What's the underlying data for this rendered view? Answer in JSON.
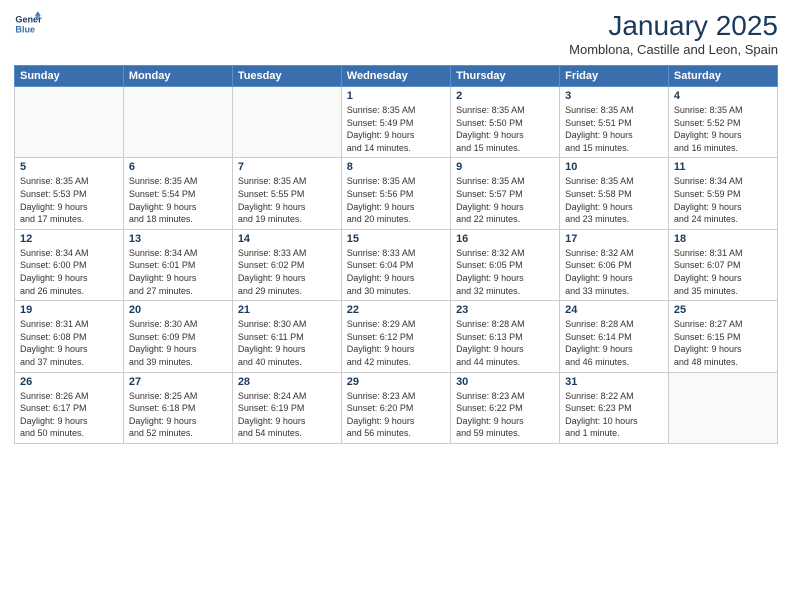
{
  "logo": {
    "line1": "General",
    "line2": "Blue"
  },
  "title": "January 2025",
  "subtitle": "Momblona, Castille and Leon, Spain",
  "weekdays": [
    "Sunday",
    "Monday",
    "Tuesday",
    "Wednesday",
    "Thursday",
    "Friday",
    "Saturday"
  ],
  "weeks": [
    [
      {
        "day": "",
        "info": ""
      },
      {
        "day": "",
        "info": ""
      },
      {
        "day": "",
        "info": ""
      },
      {
        "day": "1",
        "info": "Sunrise: 8:35 AM\nSunset: 5:49 PM\nDaylight: 9 hours\nand 14 minutes."
      },
      {
        "day": "2",
        "info": "Sunrise: 8:35 AM\nSunset: 5:50 PM\nDaylight: 9 hours\nand 15 minutes."
      },
      {
        "day": "3",
        "info": "Sunrise: 8:35 AM\nSunset: 5:51 PM\nDaylight: 9 hours\nand 15 minutes."
      },
      {
        "day": "4",
        "info": "Sunrise: 8:35 AM\nSunset: 5:52 PM\nDaylight: 9 hours\nand 16 minutes."
      }
    ],
    [
      {
        "day": "5",
        "info": "Sunrise: 8:35 AM\nSunset: 5:53 PM\nDaylight: 9 hours\nand 17 minutes."
      },
      {
        "day": "6",
        "info": "Sunrise: 8:35 AM\nSunset: 5:54 PM\nDaylight: 9 hours\nand 18 minutes."
      },
      {
        "day": "7",
        "info": "Sunrise: 8:35 AM\nSunset: 5:55 PM\nDaylight: 9 hours\nand 19 minutes."
      },
      {
        "day": "8",
        "info": "Sunrise: 8:35 AM\nSunset: 5:56 PM\nDaylight: 9 hours\nand 20 minutes."
      },
      {
        "day": "9",
        "info": "Sunrise: 8:35 AM\nSunset: 5:57 PM\nDaylight: 9 hours\nand 22 minutes."
      },
      {
        "day": "10",
        "info": "Sunrise: 8:35 AM\nSunset: 5:58 PM\nDaylight: 9 hours\nand 23 minutes."
      },
      {
        "day": "11",
        "info": "Sunrise: 8:34 AM\nSunset: 5:59 PM\nDaylight: 9 hours\nand 24 minutes."
      }
    ],
    [
      {
        "day": "12",
        "info": "Sunrise: 8:34 AM\nSunset: 6:00 PM\nDaylight: 9 hours\nand 26 minutes."
      },
      {
        "day": "13",
        "info": "Sunrise: 8:34 AM\nSunset: 6:01 PM\nDaylight: 9 hours\nand 27 minutes."
      },
      {
        "day": "14",
        "info": "Sunrise: 8:33 AM\nSunset: 6:02 PM\nDaylight: 9 hours\nand 29 minutes."
      },
      {
        "day": "15",
        "info": "Sunrise: 8:33 AM\nSunset: 6:04 PM\nDaylight: 9 hours\nand 30 minutes."
      },
      {
        "day": "16",
        "info": "Sunrise: 8:32 AM\nSunset: 6:05 PM\nDaylight: 9 hours\nand 32 minutes."
      },
      {
        "day": "17",
        "info": "Sunrise: 8:32 AM\nSunset: 6:06 PM\nDaylight: 9 hours\nand 33 minutes."
      },
      {
        "day": "18",
        "info": "Sunrise: 8:31 AM\nSunset: 6:07 PM\nDaylight: 9 hours\nand 35 minutes."
      }
    ],
    [
      {
        "day": "19",
        "info": "Sunrise: 8:31 AM\nSunset: 6:08 PM\nDaylight: 9 hours\nand 37 minutes."
      },
      {
        "day": "20",
        "info": "Sunrise: 8:30 AM\nSunset: 6:09 PM\nDaylight: 9 hours\nand 39 minutes."
      },
      {
        "day": "21",
        "info": "Sunrise: 8:30 AM\nSunset: 6:11 PM\nDaylight: 9 hours\nand 40 minutes."
      },
      {
        "day": "22",
        "info": "Sunrise: 8:29 AM\nSunset: 6:12 PM\nDaylight: 9 hours\nand 42 minutes."
      },
      {
        "day": "23",
        "info": "Sunrise: 8:28 AM\nSunset: 6:13 PM\nDaylight: 9 hours\nand 44 minutes."
      },
      {
        "day": "24",
        "info": "Sunrise: 8:28 AM\nSunset: 6:14 PM\nDaylight: 9 hours\nand 46 minutes."
      },
      {
        "day": "25",
        "info": "Sunrise: 8:27 AM\nSunset: 6:15 PM\nDaylight: 9 hours\nand 48 minutes."
      }
    ],
    [
      {
        "day": "26",
        "info": "Sunrise: 8:26 AM\nSunset: 6:17 PM\nDaylight: 9 hours\nand 50 minutes."
      },
      {
        "day": "27",
        "info": "Sunrise: 8:25 AM\nSunset: 6:18 PM\nDaylight: 9 hours\nand 52 minutes."
      },
      {
        "day": "28",
        "info": "Sunrise: 8:24 AM\nSunset: 6:19 PM\nDaylight: 9 hours\nand 54 minutes."
      },
      {
        "day": "29",
        "info": "Sunrise: 8:23 AM\nSunset: 6:20 PM\nDaylight: 9 hours\nand 56 minutes."
      },
      {
        "day": "30",
        "info": "Sunrise: 8:23 AM\nSunset: 6:22 PM\nDaylight: 9 hours\nand 59 minutes."
      },
      {
        "day": "31",
        "info": "Sunrise: 8:22 AM\nSunset: 6:23 PM\nDaylight: 10 hours\nand 1 minute."
      },
      {
        "day": "",
        "info": ""
      }
    ]
  ]
}
